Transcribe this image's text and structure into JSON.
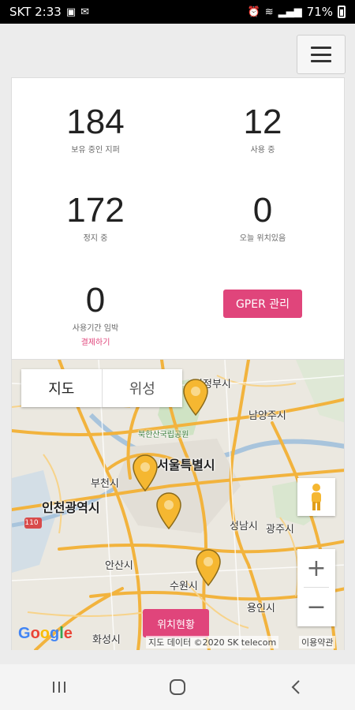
{
  "status_bar": {
    "carrier_time": "SKT 2:33",
    "battery": "71%"
  },
  "stats": [
    {
      "value": "184",
      "label": "보유 중인 지퍼"
    },
    {
      "value": "12",
      "label": "사용 중"
    },
    {
      "value": "172",
      "label": "정지 중"
    },
    {
      "value": "0",
      "label": "오늘 위치있음"
    },
    {
      "value": "0",
      "label": "사용기간 임박",
      "link": "결제하기"
    }
  ],
  "gper_button": "GPER 관리",
  "map": {
    "type_tabs": [
      "지도",
      "위성"
    ],
    "labels": {
      "uijeongbu": "의정부시",
      "namyangju": "남양주시",
      "bukhansan": "북한산국립공원",
      "seoul": "서울특별시",
      "bucheon": "부천시",
      "incheon": "인천광역시",
      "seongnam": "성남시",
      "gwangju": "광주시",
      "ansan": "안산시",
      "suwon": "수원시",
      "yongin": "용인시",
      "hwaseong": "화성시",
      "route": "110"
    },
    "location_button": "위치현황",
    "attribution": "지도 데이터 ©2020 SK telecom",
    "terms": "이용약관",
    "google_logo": "Google",
    "zoom_in": "+",
    "zoom_out": "−"
  },
  "colors": {
    "accent": "#e0457b",
    "pin": "#f5b731",
    "road": "#f2b33d"
  }
}
